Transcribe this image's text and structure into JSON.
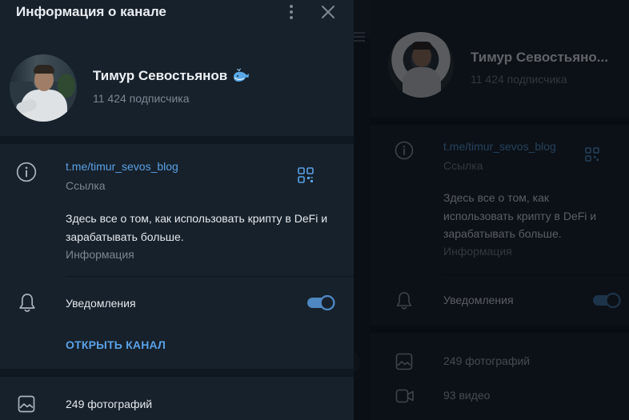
{
  "modal": {
    "title": "Информация о канале",
    "channel_name": "Тимур Севостьянов",
    "channel_emoji": "whale-icon",
    "subscribers": "11 424 подписчика",
    "link": "t.me/timur_sevos_blog",
    "link_caption": "Ссылка",
    "description": "Здесь все о том, как использовать крипту в DeFi и зарабатывать больше.",
    "description_caption": "Информация",
    "notifications_label": "Уведомления",
    "notifications_enabled": true,
    "open_channel_label": "ОТКРЫТЬ КАНАЛ",
    "photos": "249 фотографий"
  },
  "background": {
    "channel_name": "Тимур Севостьяно...",
    "subscribers": "11 424 подписчика",
    "link": "t.me/timur_sevos_blog",
    "link_caption": "Ссылка",
    "description": "Здесь все о том, как использовать крипту в DeFi и зарабатывать больше.",
    "description_caption": "Информация",
    "notifications_label": "Уведомления",
    "photos": "249 фотографий",
    "videos": "93 видео"
  },
  "colors": {
    "panel_bg": "#17212b",
    "separator": "#0f1721",
    "accent": "#5aa1e6",
    "toggle_on": "#4e87c2",
    "muted_text": "#7a8691"
  }
}
